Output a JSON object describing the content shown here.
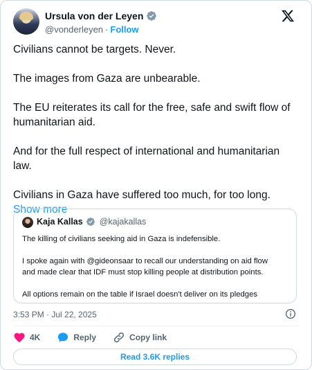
{
  "author": {
    "name": "Ursula von der Leyen",
    "handle": "@vonderleyen",
    "separator": "·",
    "follow_label": "Follow"
  },
  "platform_icon": "x-logo-icon",
  "tweet": {
    "paragraphs": [
      "Civilians cannot be targets. Never.",
      "The images from Gaza are unbearable.",
      "The EU reiterates its call for the free, safe and swift flow of humanitarian aid.",
      "And for the full respect of international and humanitarian law."
    ],
    "last_paragraph": "Civilians in Gaza have suffered too much, for too long.",
    "show_more_label": "Show more"
  },
  "quoted": {
    "name": "Kaja Kallas",
    "handle": "@kajakallas",
    "paragraphs": [
      "The killing of civilians seeking aid in Gaza is indefensible.",
      "I spoke again with @gideonsaar to recall our understanding on aid flow",
      "and made clear that IDF must stop killing people at distribution points.",
      "All options remain on the table if Israel doesn't deliver on its pledges"
    ]
  },
  "meta": {
    "timestamp": "3:53 PM · Jul 22, 2025"
  },
  "actions": {
    "like_count": "4K",
    "reply_label": "Reply",
    "copy_link_label": "Copy link"
  },
  "read_replies_label": "Read 3.6K replies",
  "colors": {
    "accent": "#1d9bf0",
    "like": "#f91880",
    "text": "#0f1419",
    "secondary": "#536471",
    "border": "#cfd9de"
  }
}
